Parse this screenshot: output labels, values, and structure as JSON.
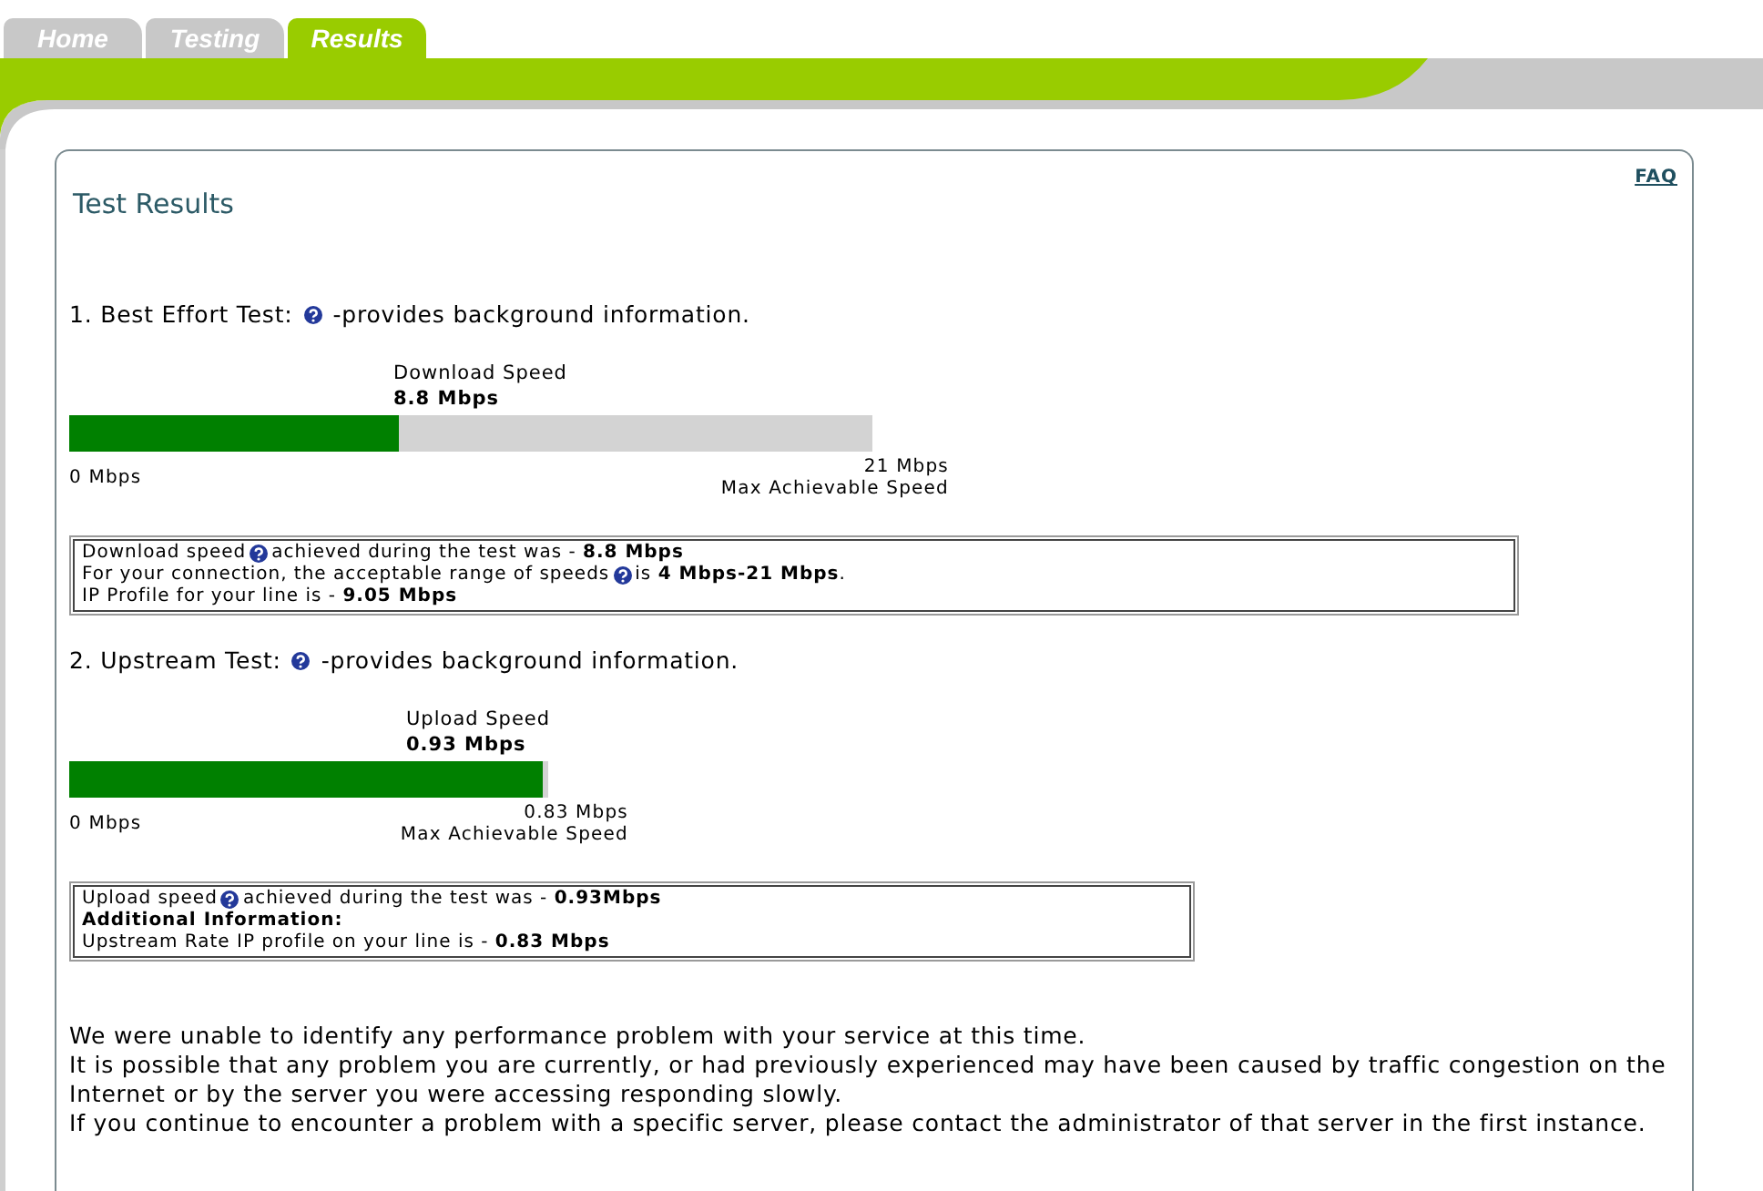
{
  "tabs": [
    {
      "label": "Home",
      "selected": false
    },
    {
      "label": "Testing",
      "selected": false
    },
    {
      "label": "Results",
      "selected": true
    }
  ],
  "panel": {
    "title": "Test Results",
    "faq_link": "FAQ"
  },
  "tests": [
    {
      "heading": "1. Best Effort Test:",
      "note": "-provides background information.",
      "meter": {
        "label": "Download Speed",
        "value": "8.8 Mbps",
        "level": 0.41,
        "min_label": "0 Mbps",
        "max_label": "21 Mbps",
        "max_caption": "Max Achievable Speed"
      },
      "details": [
        {
          "kind": "text",
          "text": "Download speed",
          "rest": "achieved during the test was - **8.8 Mbps**"
        },
        {
          "kind": "text",
          "text": "For your connection, the acceptable range of speeds",
          "rest": "is **4 Mbps-21 Mbps**."
        },
        {
          "kind": "text",
          "text": "IP Profile for your line is - **9.05 Mbps**"
        }
      ]
    },
    {
      "heading": "2. Upstream Test:",
      "note": "-provides background information.",
      "meter": {
        "label": "Upload Speed",
        "value": "0.93 Mbps",
        "level": 0.99,
        "min_label": "0 Mbps",
        "max_label": "0.83 Mbps",
        "max_caption": "Max Achievable Speed"
      },
      "details": [
        {
          "kind": "text",
          "text": "Upload speed",
          "rest": "achieved during the test was - **0.93Mbps**"
        },
        {
          "kind": "label",
          "text": "Additional Information:"
        },
        {
          "kind": "text",
          "text": "Upstream Rate IP profile on your line is - **0.83 Mbps**"
        }
      ]
    }
  ],
  "summary": [
    "We were unable to identify any performance problem with your service at this time.",
    "It is possible that any problem you are currently, or had previously experienced may have been caused by traffic congestion on the Internet or by the server you were accessing responding slowly.",
    "If you continue to encounter a problem with a specific server, please contact the administrator of that server in the first instance."
  ]
}
